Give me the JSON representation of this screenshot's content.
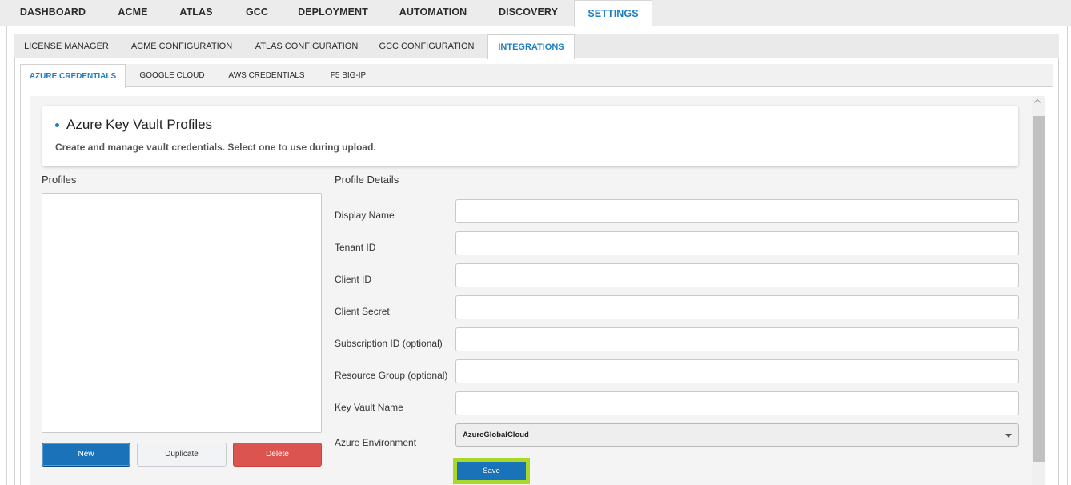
{
  "top_nav": [
    "DASHBOARD",
    "ACME",
    "ATLAS",
    "GCC",
    "DEPLOYMENT",
    "AUTOMATION",
    "DISCOVERY",
    "SETTINGS"
  ],
  "settings_tabs": [
    "LICENSE MANAGER",
    "ACME CONFIGURATION",
    "ATLAS CONFIGURATION",
    "GCC CONFIGURATION",
    "INTEGRATIONS"
  ],
  "integration_tabs": [
    "AZURE CREDENTIALS",
    "GOOGLE CLOUD",
    "AWS CREDENTIALS",
    "F5 BIG-IP"
  ],
  "header": {
    "title": "Azure Key Vault Profiles",
    "description": "Create and manage vault credentials. Select one to use during upload."
  },
  "profiles": {
    "label": "Profiles",
    "items": [],
    "new_label": "New",
    "duplicate_label": "Duplicate",
    "delete_label": "Delete"
  },
  "details": {
    "label": "Profile Details",
    "fields": [
      {
        "label": "Display Name",
        "value": ""
      },
      {
        "label": "Tenant ID",
        "value": ""
      },
      {
        "label": "Client ID",
        "value": ""
      },
      {
        "label": "Client Secret",
        "value": ""
      },
      {
        "label": "Subscription ID (optional)",
        "value": ""
      },
      {
        "label": "Resource Group (optional)",
        "value": ""
      },
      {
        "label": "Key Vault Name",
        "value": ""
      }
    ],
    "environment_label": "Azure Environment",
    "environment_value": "AzureGlobalCloud",
    "save_label": "Save"
  },
  "colors": {
    "accent": "#1f7fc3",
    "primary_button": "#1a73b8",
    "danger_button": "#dc5450",
    "highlight": "#a8d82a"
  }
}
